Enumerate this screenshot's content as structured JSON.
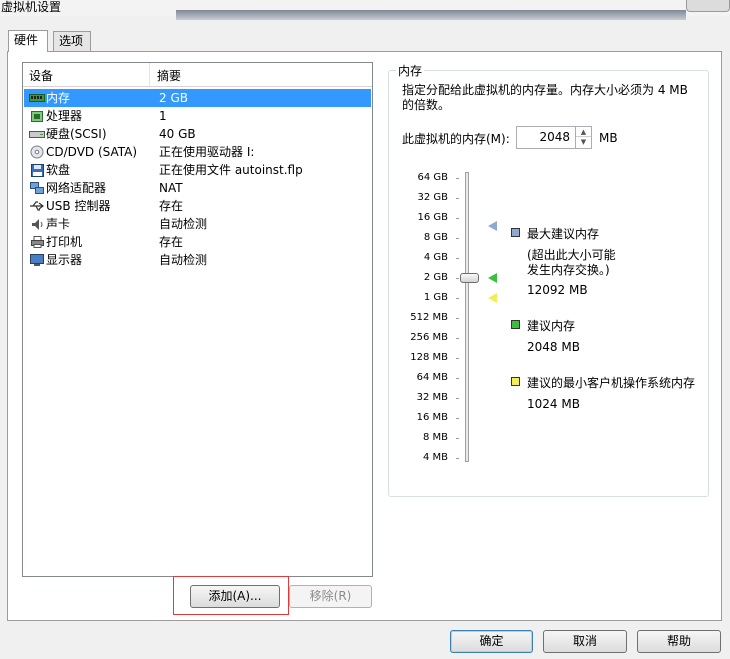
{
  "window": {
    "title": "虚拟机设置"
  },
  "tabs": [
    {
      "label": "硬件"
    },
    {
      "label": "选项"
    }
  ],
  "hardware_list": {
    "columns": {
      "device": "设备",
      "summary": "摘要"
    },
    "rows": [
      {
        "icon": "memory-icon",
        "name": "内存",
        "summary": "2 GB",
        "selected": true
      },
      {
        "icon": "cpu-icon",
        "name": "处理器",
        "summary": "1"
      },
      {
        "icon": "hard-disk-icon",
        "name": "硬盘(SCSI)",
        "summary": "40 GB"
      },
      {
        "icon": "cd-dvd-icon",
        "name": "CD/DVD (SATA)",
        "summary": "正在使用驱动器 I:"
      },
      {
        "icon": "floppy-icon",
        "name": "软盘",
        "summary": "正在使用文件 autoinst.flp"
      },
      {
        "icon": "network-icon",
        "name": "网络适配器",
        "summary": "NAT"
      },
      {
        "icon": "usb-icon",
        "name": "USB 控制器",
        "summary": "存在"
      },
      {
        "icon": "sound-icon",
        "name": "声卡",
        "summary": "自动检测"
      },
      {
        "icon": "printer-icon",
        "name": "打印机",
        "summary": "存在"
      },
      {
        "icon": "display-icon",
        "name": "显示器",
        "summary": "自动检测"
      }
    ]
  },
  "list_buttons": {
    "add": "添加(A)...",
    "remove": "移除(R)"
  },
  "memory_panel": {
    "group_title": "内存",
    "description": "指定分配给此虚拟机的内存量。内存大小必须为 4 MB 的倍数。",
    "field_label": "此虚拟机的内存(M):",
    "value": "2048",
    "unit": "MB",
    "scale_ticks": [
      "64 GB",
      "32 GB",
      "16 GB",
      "8 GB",
      "4 GB",
      "2 GB",
      "1 GB",
      "512 MB",
      "256 MB",
      "128 MB",
      "64 MB",
      "32 MB",
      "16 MB",
      "8 MB",
      "4 MB"
    ],
    "slider_value_mb": 2048,
    "legend": {
      "max": {
        "title": "最大建议内存",
        "note": "(超出此大小可能 发生内存交换。)",
        "value": "12092 MB",
        "color": "#8ea9d4"
      },
      "recommended": {
        "title": "建议内存",
        "value": "2048 MB",
        "color": "#3cbf3c"
      },
      "guest_min": {
        "title": "建议的最小客户机操作系统内存",
        "value": "1024 MB",
        "color": "#f2ee58"
      }
    }
  },
  "dialog_buttons": {
    "ok": "确定",
    "cancel": "取消",
    "help": "帮助"
  }
}
